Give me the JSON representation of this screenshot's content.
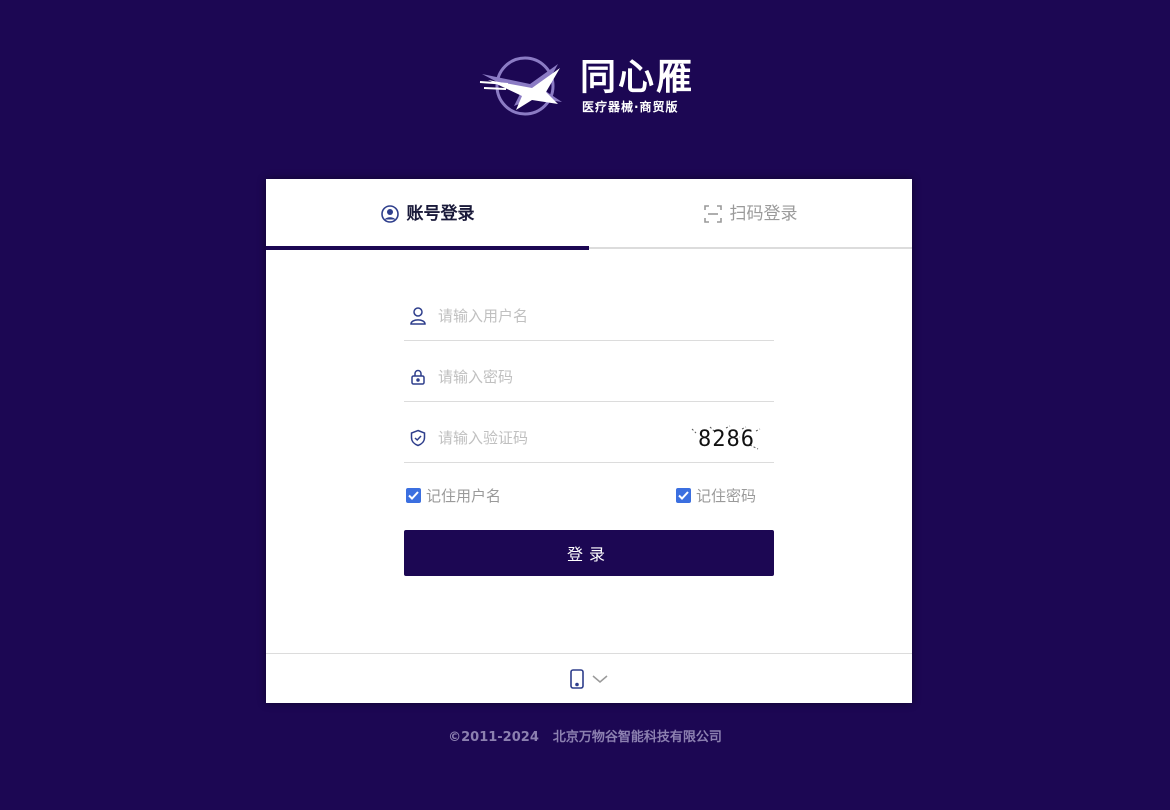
{
  "brand": {
    "title": "同心雁",
    "subtitle": "医疗器械·商贸版"
  },
  "tabs": [
    {
      "label": "账号登录",
      "icon": "user-circle-icon",
      "active": true
    },
    {
      "label": "扫码登录",
      "icon": "scan-icon",
      "active": false
    }
  ],
  "form": {
    "username_placeholder": "请输入用户名",
    "password_placeholder": "请输入密码",
    "captcha_placeholder": "请输入验证码",
    "captcha_code": "8286",
    "remember_username": {
      "label": "记住用户名",
      "checked": true
    },
    "remember_password": {
      "label": "记住密码",
      "checked": true
    },
    "submit_label": "登录"
  },
  "footer": {
    "years": "©2011-2024",
    "company": "北京万物谷智能科技有限公司"
  },
  "colors": {
    "background": "#1c0753",
    "primary": "#1c0753",
    "checkbox": "#3b6fe0",
    "icon": "#2e3e8c"
  }
}
